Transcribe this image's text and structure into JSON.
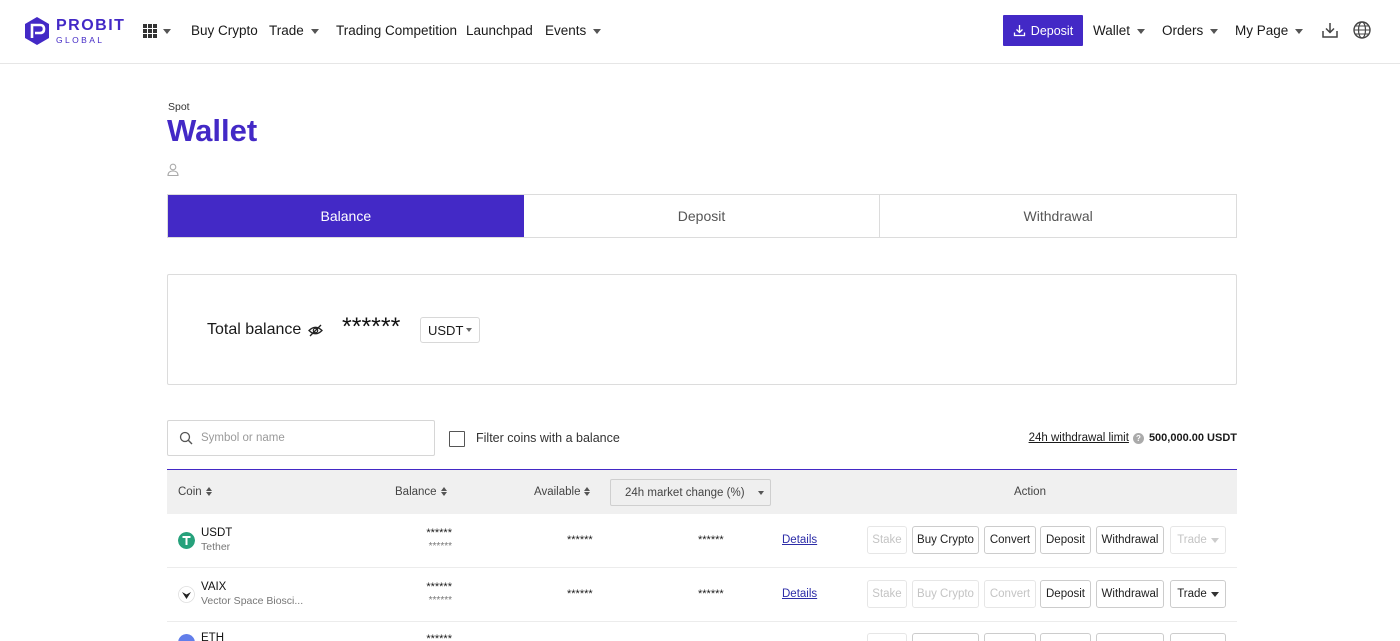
{
  "brand": {
    "name": "PROBIT",
    "sub": "GLOBAL",
    "color": "#4329c6"
  },
  "nav": {
    "apps_icon": "apps-grid-icon",
    "items": [
      {
        "label": "Buy Crypto",
        "caret": false
      },
      {
        "label": "Trade",
        "caret": true
      },
      {
        "label": "Trading Competition",
        "caret": false
      },
      {
        "label": "Launchpad",
        "caret": false
      },
      {
        "label": "Events",
        "caret": true
      }
    ],
    "deposit_label": "Deposit",
    "right_items": [
      {
        "label": "Wallet",
        "caret": true
      },
      {
        "label": "Orders",
        "caret": true
      },
      {
        "label": "My Page",
        "caret": true
      }
    ],
    "download_icon": "download-icon",
    "language_icon": "globe-icon"
  },
  "page": {
    "crumb": "Spot",
    "title": "Wallet"
  },
  "tabs": [
    {
      "label": "Balance",
      "active": true
    },
    {
      "label": "Deposit",
      "active": false
    },
    {
      "label": "Withdrawal",
      "active": false
    }
  ],
  "total_balance": {
    "label": "Total balance",
    "value": "******",
    "currency": "USDT"
  },
  "filters": {
    "search_placeholder": "Symbol or name",
    "filter_label": "Filter coins with a balance",
    "limit_label": "24h withdrawal limit",
    "limit_value": "500,000.00 USDT"
  },
  "table": {
    "headers": {
      "coin": "Coin",
      "balance": "Balance",
      "available": "Available",
      "change": "24h market change (%)",
      "action": "Action"
    },
    "rows": [
      {
        "symbol": "USDT",
        "name": "Tether",
        "icon_color": "#26a17b",
        "balance": "******",
        "balance_sub": "******",
        "available": "******",
        "change": "******",
        "details": "Details",
        "actions": {
          "stake": "Stake",
          "buy": "Buy Crypto",
          "convert": "Convert",
          "deposit": "Deposit",
          "withdrawal": "Withdrawal",
          "trade": "Trade"
        }
      },
      {
        "symbol": "VAIX",
        "name": "Vector Space Biosci...",
        "icon_color": "#222222",
        "balance": "******",
        "balance_sub": "******",
        "available": "******",
        "change": "******",
        "details": "Details",
        "actions": {
          "stake": "Stake",
          "buy": "Buy Crypto",
          "convert": "Convert",
          "deposit": "Deposit",
          "withdrawal": "Withdrawal",
          "trade": "Trade"
        }
      },
      {
        "symbol": "ETH",
        "balance": "******"
      }
    ]
  }
}
